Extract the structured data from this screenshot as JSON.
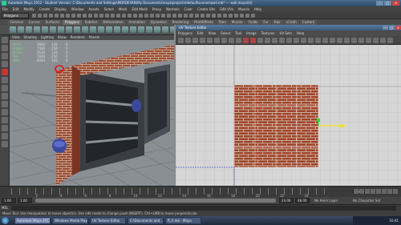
{
  "app": {
    "title": "Autodesk Maya 2012 - Student Version: C:\\Documents and Settings\\MORDEVAN\\My Documents\\maya\\projects\\default\\scenes\\wall.mb*   ---   wall.mayal[4]",
    "menus": [
      "File",
      "Edit",
      "Modify",
      "Create",
      "Display",
      "Window",
      "Assets",
      "Select",
      "Mesh",
      "Edit Mesh",
      "Proxy",
      "Normals",
      "Color",
      "Create UVs",
      "Edit UVs",
      "Muscle",
      "Help"
    ],
    "mode": "Polygons"
  },
  "shelf": {
    "tabs": [
      "General",
      "Curves",
      "Surfaces",
      "Polygons",
      "Subdivs",
      "Deformation",
      "Animation",
      "Dynamics",
      "Rendering",
      "PaintEffects",
      "Toon",
      "Muscle",
      "Fluids",
      "Fur",
      "Hair",
      "nCloth",
      "Custom"
    ],
    "active_tab": "Polygons"
  },
  "viewport": {
    "menus": [
      "View",
      "Shading",
      "Lighting",
      "Show",
      "Renderer",
      "Panels"
    ],
    "hud": [
      {
        "label": "Verts:",
        "values": [
          "3864",
          "128",
          "0"
        ]
      },
      {
        "label": "Edges:",
        "values": [
          "7480",
          "256",
          "0"
        ]
      },
      {
        "label": "Faces:",
        "values": [
          "3520",
          "128",
          "0"
        ]
      },
      {
        "label": "Tris:",
        "values": [
          "7040",
          "256",
          "0"
        ]
      },
      {
        "label": "UVs:",
        "values": [
          "4094",
          "145",
          "0"
        ]
      }
    ]
  },
  "uv_editor": {
    "title": "UV Texture Editor",
    "menus": [
      "Polygons",
      "Edit",
      "View",
      "Select",
      "Tool",
      "Image",
      "Textures",
      "UV Sets",
      "Help"
    ]
  },
  "timeline": {
    "tick_numbers": [
      "2",
      "4",
      "6",
      "8",
      "10",
      "12",
      "14",
      "16",
      "18",
      "20",
      "22",
      "24"
    ],
    "current_frame": "1.00"
  },
  "range": {
    "start": "1.00",
    "inner_start": "1.00",
    "inner_end": "24.00",
    "end": "48.00",
    "anim_layer_label": "No Anim Layer",
    "char_set_label": "No Character Set"
  },
  "command": {
    "label": "MEL"
  },
  "helpline": "Move Tool: Use manipulator to move object(s). Use edit mode to change pivot (INSERT). Ctrl+LMB to move perpendicular.",
  "taskbar": {
    "tasks": [
      "Autodesk Maya 2012...",
      "Windows Media Player",
      "UV Texture Editor",
      "C:\\Documents and ...",
      "fl_rl.mb - Maya"
    ],
    "active_index": 0,
    "clock": "10:41"
  },
  "colors": {
    "brick": "#a2432a",
    "mortar": "#c9b9a5",
    "hud_label": "#7fd47f",
    "uv_grid": "#b8b8b8",
    "uv_selection": "#ffffff",
    "manip_x": "#f2e21a",
    "manip_y": "#2fd62f",
    "selected_vertex_highlight": "#e01010"
  }
}
